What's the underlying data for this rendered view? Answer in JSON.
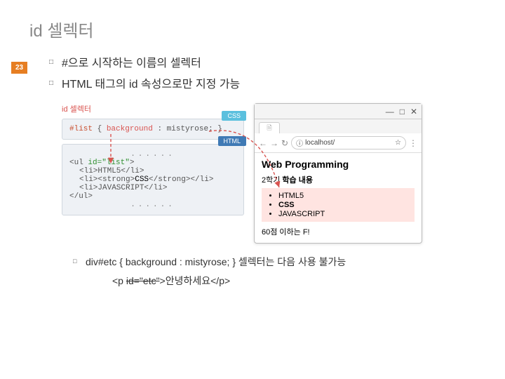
{
  "title": "id 셀렉터",
  "page_number": "23",
  "bullets": [
    "#으로 시작하는 이름의 셀렉터",
    "HTML 태그의 id 속성으로만 지정 가능"
  ],
  "code_panel": {
    "caption": "id 셀렉터",
    "css_label": "CSS",
    "html_label": "HTML",
    "css_line_selector": "#list",
    "css_line_open": " { ",
    "css_line_prop": "background",
    "css_line_colon": " : ",
    "css_line_value": "mistyrose",
    "css_line_close": "; }",
    "dots": "......",
    "html_lines": {
      "ul_open": "<ul ",
      "ul_attr": "id=\"list\"",
      "ul_open_end": ">",
      "li1": "<li>HTML5</li>",
      "li2a": "<li><strong>",
      "li2b": "CSS",
      "li2c": "</strong></li>",
      "li3": "<li>JAVASCRIPT</li>",
      "ul_close": "</ul>"
    }
  },
  "browser": {
    "win_min": "—",
    "win_max": "□",
    "win_close": "✕",
    "tab_icon": "🗎",
    "back": "←",
    "forward": "→",
    "reload": "↻",
    "info_icon": "ⓘ",
    "url": "localhost/",
    "star": "☆",
    "menu": "⋮",
    "wp_title": "Web Programming",
    "semester_prefix": "2학기 ",
    "semester_bold": "학습 내용",
    "list": [
      "HTML5",
      "CSS",
      "JAVASCRIPT"
    ],
    "footer": "60점 이하는 F!"
  },
  "sub_bullet": {
    "line1": "div#etc { background : mistyrose; } 셀렉터는 다음 사용 불가능",
    "code_prefix": "<p ",
    "code_strike": "id=\"etc\"",
    "code_suffix": ">안녕하세요</p>"
  }
}
